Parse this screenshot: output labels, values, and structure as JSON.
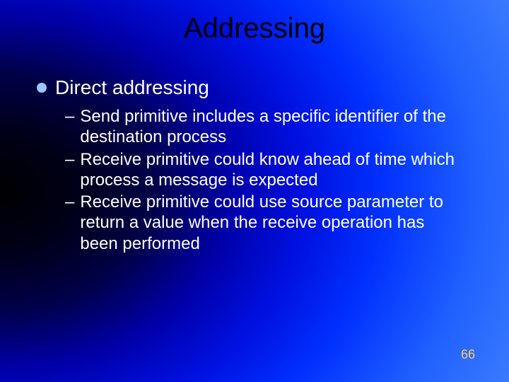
{
  "title": "Addressing",
  "bullet": {
    "text": "Direct addressing"
  },
  "subpoints": [
    "Send primitive includes a specific identifier of the destination process",
    "Receive primitive could know ahead of time which process a message is expected",
    "Receive primitive could use source parameter to return a value when the receive operation has been performed"
  ],
  "page_number": "66"
}
